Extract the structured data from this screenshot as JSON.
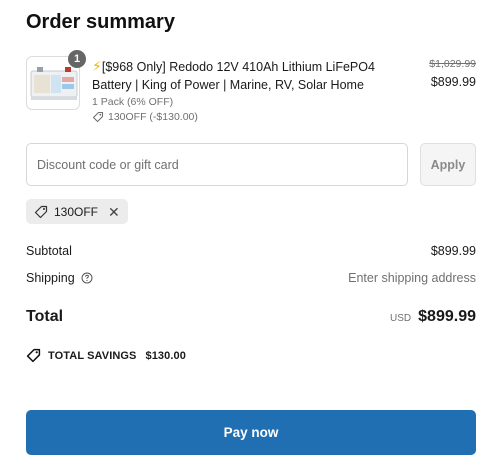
{
  "header": {
    "title": "Order summary"
  },
  "product": {
    "quantity": "1",
    "icon": "lightning-bolt-icon",
    "title_text": "[$968 Only] Redodo 12V 410Ah Lithium LiFePO4 Battery | King of Power | Marine, RV, Solar Home",
    "variant": "1 Pack (6% OFF)",
    "discount_line": "130OFF (-$130.00)",
    "compare_price": "$1,029.99",
    "price": "$899.99"
  },
  "discount": {
    "placeholder": "Discount code or gift card",
    "value": "",
    "apply_label": "Apply",
    "applied_code": "130OFF"
  },
  "summary": {
    "subtotal_label": "Subtotal",
    "subtotal_value": "$899.99",
    "shipping_label": "Shipping",
    "shipping_value": "Enter shipping address",
    "total_label": "Total",
    "currency": "USD",
    "total_value": "$899.99",
    "savings_label": "TOTAL SAVINGS",
    "savings_value": "$130.00"
  },
  "actions": {
    "pay_label": "Pay now"
  },
  "colors": {
    "primary_button": "#1f6fb2",
    "bolt": "#f2b400"
  }
}
